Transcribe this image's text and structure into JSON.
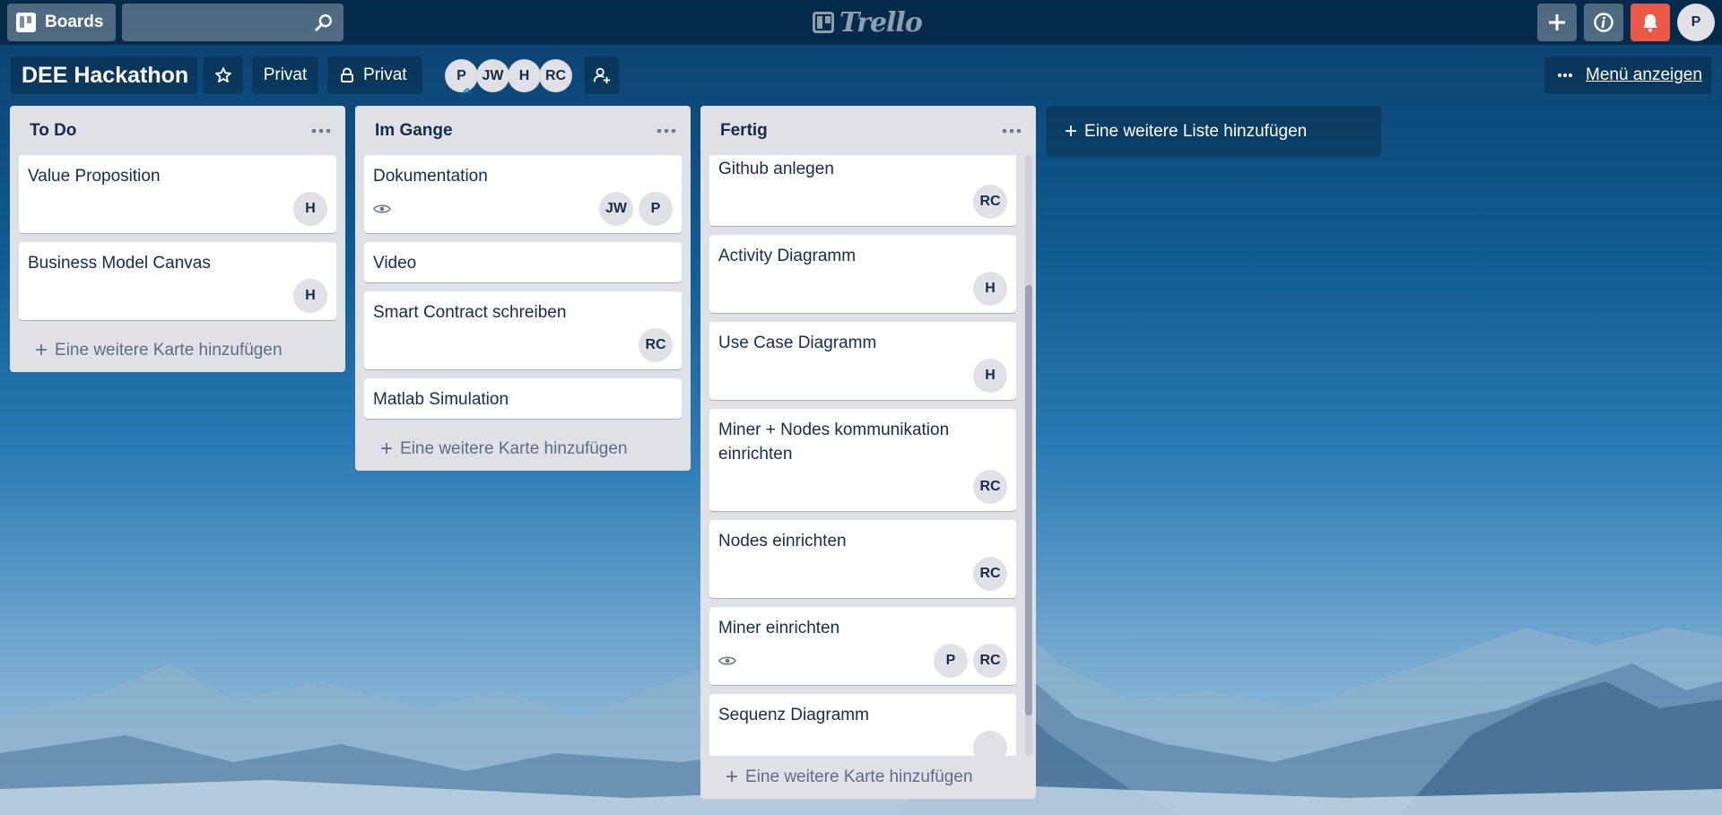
{
  "topbar": {
    "boards_label": "Boards",
    "search_placeholder": "",
    "logo_text": "Trello",
    "user_initial": "P"
  },
  "board": {
    "title": "DEE Hackathon",
    "visibility_label": "Privat",
    "team_label": "Privat",
    "members": [
      "P",
      "JW",
      "H",
      "RC"
    ],
    "menu_label": "Menü anzeigen"
  },
  "lists": [
    {
      "title": "To Do",
      "cards": [
        {
          "title": "Value Proposition",
          "members": [
            "H"
          ],
          "watching": false
        },
        {
          "title": "Business Model Canvas",
          "members": [
            "H"
          ],
          "watching": false
        }
      ],
      "add_card_label": "Eine weitere Karte hinzufügen"
    },
    {
      "title": "Im Gange",
      "cards": [
        {
          "title": "Dokumentation",
          "members": [
            "JW",
            "P"
          ],
          "watching": true
        },
        {
          "title": "Video",
          "members": [],
          "watching": false
        },
        {
          "title": "Smart Contract schreiben",
          "members": [
            "RC"
          ],
          "watching": false
        },
        {
          "title": "Matlab Simulation",
          "members": [],
          "watching": false
        }
      ],
      "add_card_label": "Eine weitere Karte hinzufügen"
    },
    {
      "title": "Fertig",
      "cards": [
        {
          "title": "Github anlegen",
          "members": [
            "RC"
          ],
          "watching": false
        },
        {
          "title": "Activity Diagramm",
          "members": [
            "H"
          ],
          "watching": false
        },
        {
          "title": "Use Case Diagramm",
          "members": [
            "H"
          ],
          "watching": false
        },
        {
          "title": "Miner + Nodes kommunikation einrichten",
          "members": [
            "RC"
          ],
          "watching": false
        },
        {
          "title": "Nodes einrichten",
          "members": [
            "RC"
          ],
          "watching": false
        },
        {
          "title": "Miner einrichten",
          "members": [
            "P",
            "RC"
          ],
          "watching": true
        },
        {
          "title": "Sequenz Diagramm",
          "members": [
            ""
          ],
          "watching": false
        }
      ],
      "add_card_label": "Eine weitere Karte hinzufügen"
    }
  ],
  "add_list_label": "Eine weitere Liste hinzufügen",
  "colors": {
    "notification_button": "#eb5a46",
    "list_background": "#dfe1e6"
  }
}
